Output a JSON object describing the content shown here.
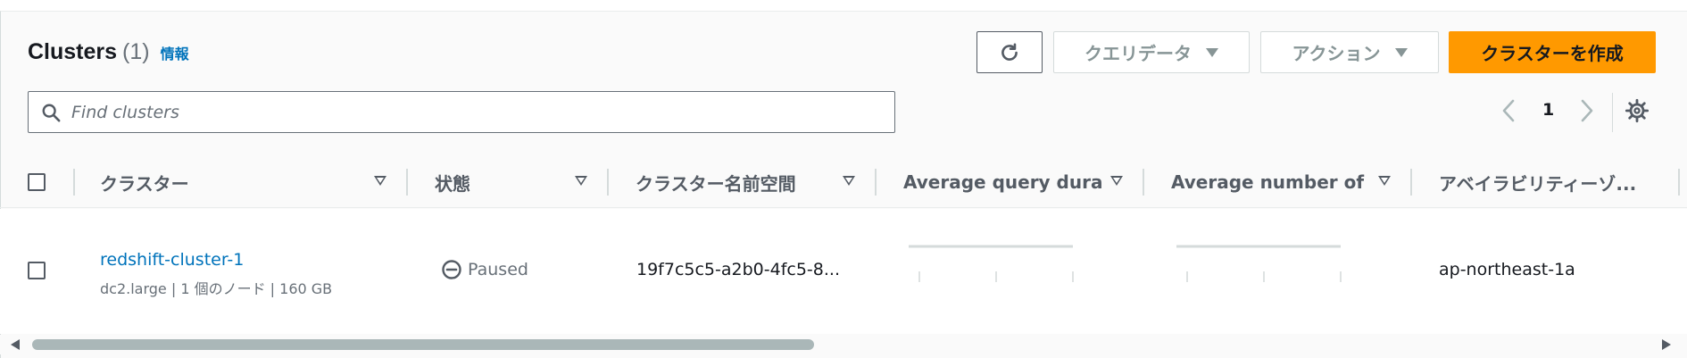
{
  "header": {
    "title": "Clusters",
    "count": "(1)",
    "info_link": "情報"
  },
  "toolbar": {
    "refresh_icon": "refresh-icon",
    "query_editor_label": "クエリデータ",
    "actions_label": "アクション",
    "create_label": "クラスターを作成"
  },
  "search": {
    "placeholder": "Find clusters",
    "value": ""
  },
  "pagination": {
    "current_page": "1"
  },
  "table": {
    "columns": [
      "クラスター",
      "状態",
      "クラスター名前空間",
      "Average query dura...",
      "Average number of ...",
      "アベイラビリティーゾ..."
    ],
    "rows": [
      {
        "name": "redshift-cluster-1",
        "meta": "dc2.large | 1 個のノード | 160 GB",
        "status": "Paused",
        "namespace": "19f7c5c5-a2b0-4fc5-8...",
        "availability_zone": "ap-northeast-1a"
      }
    ]
  },
  "colors": {
    "accent_link": "#0073bb",
    "primary_button": "#ff9900",
    "text_primary": "#16191f",
    "text_secondary": "#687078"
  }
}
